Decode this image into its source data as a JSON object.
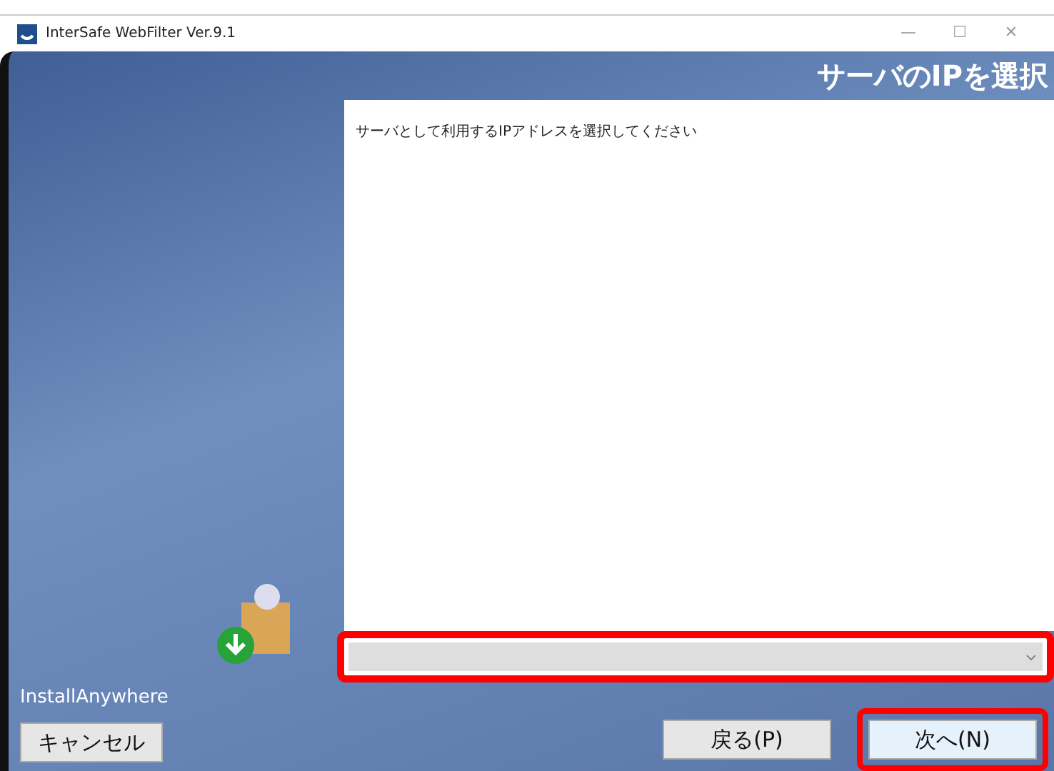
{
  "window": {
    "title": "InterSafe WebFilter Ver.9.1",
    "controls": [
      "—",
      "☐",
      "✕"
    ]
  },
  "header": {
    "title": "サーバのIPを選択"
  },
  "content": {
    "instruction": "サーバとして利用するIPアドレスを選択してください"
  },
  "dropdown": {
    "highlighted": true
  },
  "sidebar": {
    "brand": "InstallAnywhere"
  },
  "buttons": [
    {
      "label": "キャンセル",
      "kind": "cancel",
      "highlighted": false
    },
    {
      "label": "戻る(P)",
      "kind": "back",
      "highlighted": false
    },
    {
      "label": "次へ(N)",
      "kind": "next",
      "highlighted": true
    }
  ]
}
